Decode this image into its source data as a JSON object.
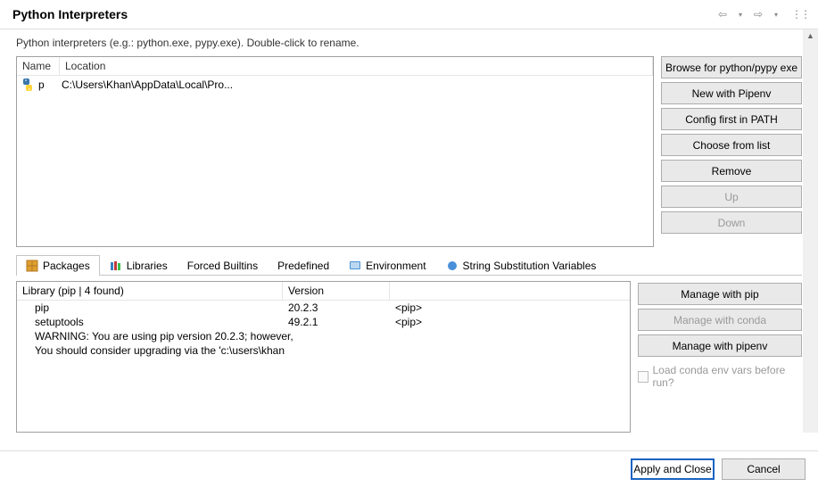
{
  "title": "Python Interpreters",
  "subtitle": "Python interpreters (e.g.: python.exe, pypy.exe).   Double-click to rename.",
  "table": {
    "headers": {
      "name": "Name",
      "location": "Location"
    },
    "rows": [
      {
        "name": "p",
        "location": "C:\\Users\\Khan\\AppData\\Local\\Pro..."
      }
    ]
  },
  "side_buttons": {
    "browse": "Browse for python/pypy exe",
    "pipenv": "New with Pipenv",
    "config": "Config first in PATH",
    "choose": "Choose from list",
    "remove": "Remove",
    "up": "Up",
    "down": "Down"
  },
  "tabs": {
    "packages": "Packages",
    "libraries": "Libraries",
    "builtins": "Forced Builtins",
    "predefined": "Predefined",
    "env": "Environment",
    "subst": "String Substitution Variables"
  },
  "packages": {
    "headers": {
      "library": "Library (pip | 4 found)",
      "version": "Version"
    },
    "rows": [
      {
        "lib": "pip",
        "ver": "20.2.3",
        "src": "<pip>"
      },
      {
        "lib": "setuptools",
        "ver": "49.2.1",
        "src": "<pip>"
      },
      {
        "lib": "WARNING: You are using pip version 20.2.3; however,",
        "ver": "",
        "src": ""
      },
      {
        "lib": "You should consider upgrading via the 'c:\\users\\khan",
        "ver": "",
        "src": ""
      }
    ],
    "side": {
      "pip": "Manage with pip",
      "conda": "Manage with conda",
      "pipenv": "Manage with pipenv",
      "checkbox": "Load conda env vars before run?"
    }
  },
  "footer": {
    "apply": "Apply and Close",
    "cancel": "Cancel"
  }
}
